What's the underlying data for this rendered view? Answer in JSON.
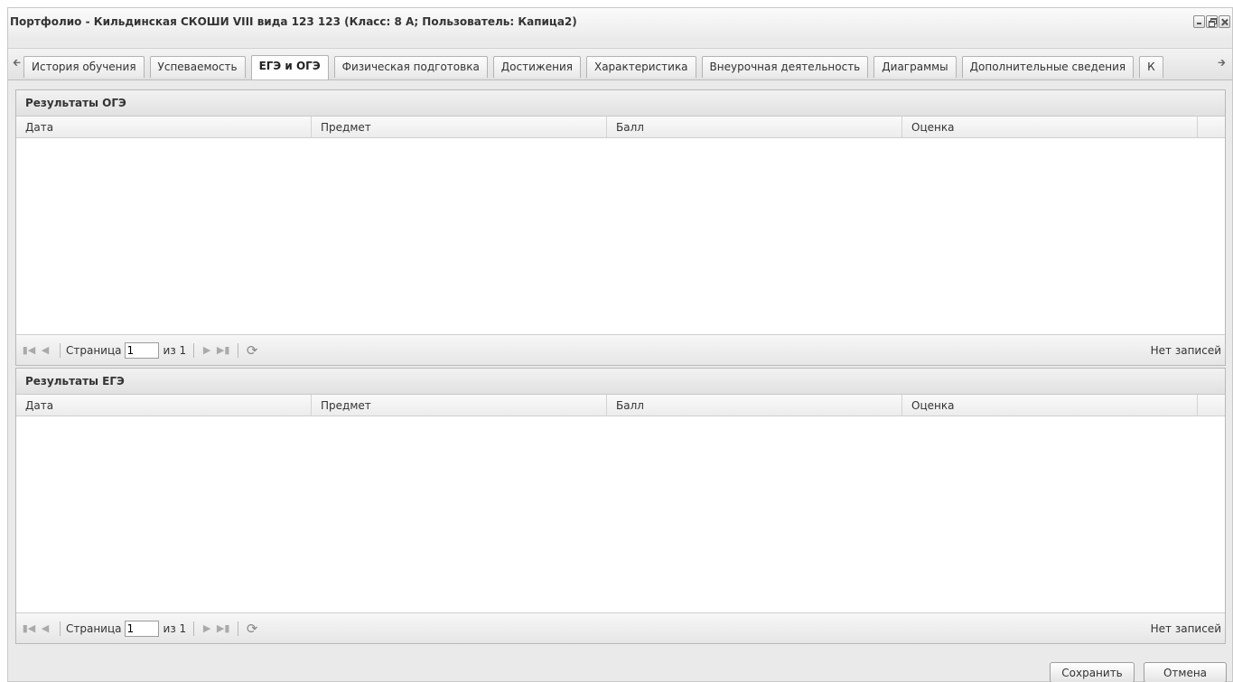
{
  "window": {
    "title": "Портфолио - Кильдинская СКОШИ VIII вида 123 123 (Класс: 8 А; Пользователь: Капица2)"
  },
  "tabs": [
    {
      "label": "История обучения",
      "active": false
    },
    {
      "label": "Успеваемость",
      "active": false
    },
    {
      "label": "ЕГЭ и ОГЭ",
      "active": true
    },
    {
      "label": "Физическая подготовка",
      "active": false
    },
    {
      "label": "Достижения",
      "active": false
    },
    {
      "label": "Характеристика",
      "active": false
    },
    {
      "label": "Внеурочная деятельность",
      "active": false
    },
    {
      "label": "Диаграммы",
      "active": false
    },
    {
      "label": "Дополнительные сведения",
      "active": false
    },
    {
      "label": "К",
      "active": false
    }
  ],
  "icons": {
    "scroll_left": "arrow-left-icon",
    "scroll_right": "arrow-right-icon",
    "first_page": "first-page-icon",
    "prev_page": "prev-page-icon",
    "next_page": "next-page-icon",
    "last_page": "last-page-icon",
    "refresh": "refresh-icon"
  },
  "oge": {
    "title": "Результаты ОГЭ",
    "columns": [
      "Дата",
      "Предмет",
      "Балл",
      "Оценка"
    ],
    "rows": [],
    "pager": {
      "page_label": "Страница",
      "page_value": "1",
      "of_label": "из 1",
      "empty_text": "Нет записей"
    }
  },
  "ege": {
    "title": "Результаты ЕГЭ",
    "columns": [
      "Дата",
      "Предмет",
      "Балл",
      "Оценка"
    ],
    "rows": [],
    "pager": {
      "page_label": "Страница",
      "page_value": "1",
      "of_label": "из 1",
      "empty_text": "Нет записей"
    }
  },
  "footer": {
    "save_label": "Сохранить",
    "cancel_label": "Отмена"
  },
  "colors": {
    "window_bg": "#eaeaea",
    "panel_header_bg": "#e1e1e1",
    "border": "#b8b8b8"
  }
}
